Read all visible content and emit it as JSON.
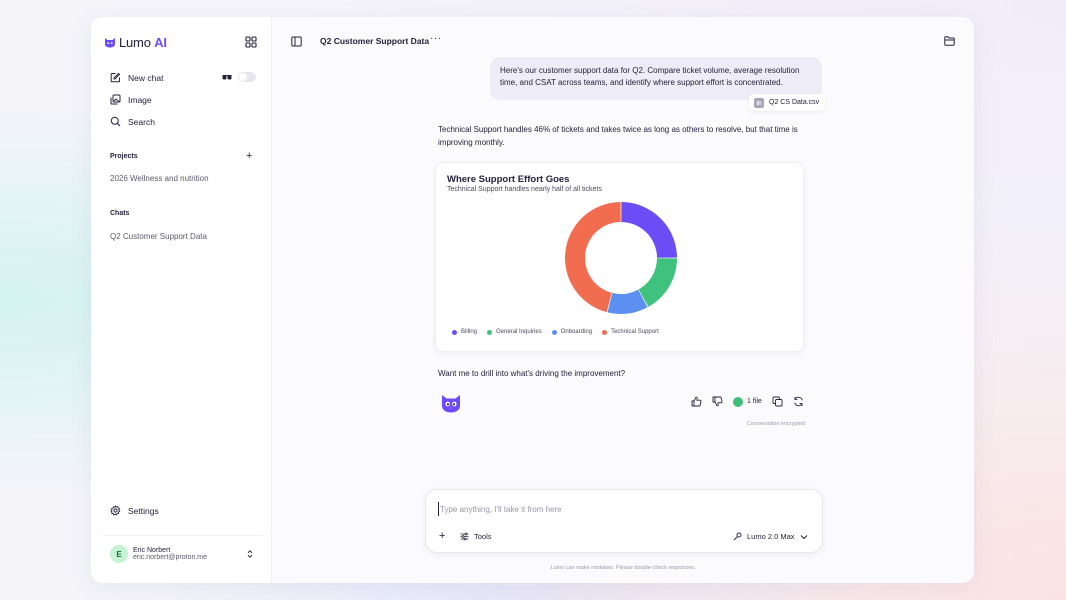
{
  "brand": {
    "name": "Lumo",
    "suffix": "AI",
    "accent": "#6d4aff"
  },
  "sidebar": {
    "nav": [
      {
        "label": "New chat",
        "icon": "edit-icon"
      },
      {
        "label": "Image",
        "icon": "image-stack-icon"
      },
      {
        "label": "Search",
        "icon": "search-icon"
      }
    ],
    "projects_title": "Projects",
    "projects": [
      "2026 Wellness and nutrition"
    ],
    "chats_title": "Chats",
    "chats": [
      "Q2 Customer Support Data"
    ],
    "settings_label": "Settings",
    "user": {
      "initial": "E",
      "name": "Eric Norbert",
      "email": "eric.norbert@proton.me"
    }
  },
  "chat": {
    "title": "Q2 Customer Support Data",
    "user_message": "Here's our customer support data for Q2. Compare ticket volume, average resolution time, and CSAT across teams, and identify where support effort is concentrated.",
    "attachment": "Q2 CS Data.csv",
    "answer": "Technical Support handles 46% of tickets and takes twice as long as others to resolve, but that time is improving monthly.",
    "followup": "Want me to drill into what's driving the improvement?",
    "files_label": "1 file",
    "encrypted_label": "Conversation encrypted"
  },
  "chart_data": {
    "type": "pie",
    "title": "Where Support Effort Goes",
    "subtitle": "Technical Support handles nearly half of all tickets",
    "categories": [
      "Billing",
      "General Inquiries",
      "Onboarding",
      "Technical Support"
    ],
    "values": [
      25,
      17,
      12,
      46
    ],
    "colors": [
      "#6b4df5",
      "#3fc27d",
      "#5b8ff0",
      "#f26d4f"
    ],
    "legend": "bottom-left",
    "donut": true
  },
  "composer": {
    "placeholder": "Type anything, I'll take it from here",
    "tools_label": "Tools",
    "model_label": "Lumo 2.0 Max",
    "disclaimer": "Lumo can make mistakes. Please double-check responses."
  }
}
